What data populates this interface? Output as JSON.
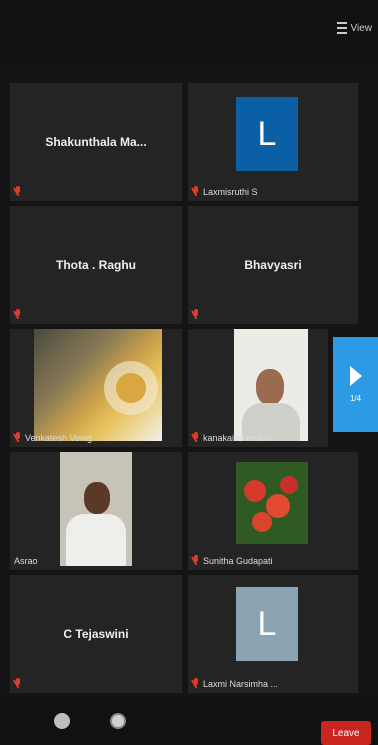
{
  "top": {
    "view_label": "View"
  },
  "tiles": {
    "t1": {
      "center_name": "Shakunthala  Ma..."
    },
    "t2": {
      "avatar_letter": "L",
      "label": "Laxmisruthi S"
    },
    "t3": {
      "center_name": "Thota . Raghu"
    },
    "t4": {
      "center_name": "Bhavyasri"
    },
    "t5": {
      "label": "Venkatesh Venig"
    },
    "t6": {
      "label": "kanakaiah neduri"
    },
    "t7": {
      "label": "Asrao"
    },
    "t8": {
      "label": "Sunitha Gudapati"
    },
    "t9": {
      "center_name": "C Tejaswini"
    },
    "t10": {
      "avatar_letter": "L",
      "label": "Laxmi Narsimha ..."
    }
  },
  "nav": {
    "page": "1/4"
  },
  "bottom": {
    "leave_label": "Leave"
  },
  "colors": {
    "accent_blue": "#2d9ae6",
    "avatar_blue": "#0b5fa5",
    "avatar_gray": "#8aa4b3",
    "leave_red": "#c9261f",
    "mute_red": "#e03b2a"
  }
}
